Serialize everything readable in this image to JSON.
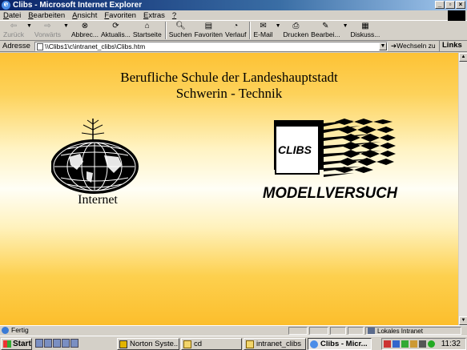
{
  "window": {
    "title": "Clibs - Microsoft Internet Explorer"
  },
  "menu": {
    "items": [
      {
        "first": "D",
        "rest": "atei"
      },
      {
        "first": "B",
        "rest": "earbeiten"
      },
      {
        "first": "A",
        "rest": "nsicht"
      },
      {
        "first": "F",
        "rest": "avoriten"
      },
      {
        "first": "E",
        "rest": "xtras"
      },
      {
        "first": "?",
        "rest": ""
      }
    ]
  },
  "toolbar": {
    "back": "Zurück",
    "forward": "Vorwärts",
    "stop": "Abbrec...",
    "refresh": "Aktualis...",
    "home": "Startseite",
    "search": "Suchen",
    "favorites": "Favoriten",
    "history": "Verlauf",
    "mail": "E-Mail",
    "print": "Drucken",
    "edit": "Bearbei...",
    "discuss": "Diskuss..."
  },
  "address": {
    "label": "Adresse",
    "value": "\\\\Clibs1\\c\\intranet_clibs\\Clibs.htm",
    "go": "Wechseln zu",
    "links": "Links"
  },
  "page": {
    "heading_line1": "Berufliche Schule der Landeshauptstadt",
    "heading_line2": "Schwerin - Technik",
    "internet_label": "Internet",
    "clibs_logo_text": "CLIBS",
    "modellversuch_text": "MODELLVERSUCH"
  },
  "status": {
    "text": "Fertig",
    "zone": "Lokales Intranet"
  },
  "taskbar": {
    "start": "Start",
    "tasks": [
      "Norton Syste...",
      "cd",
      "intranet_clibs",
      "Clibs - Micr..."
    ],
    "clock": "11:32"
  }
}
